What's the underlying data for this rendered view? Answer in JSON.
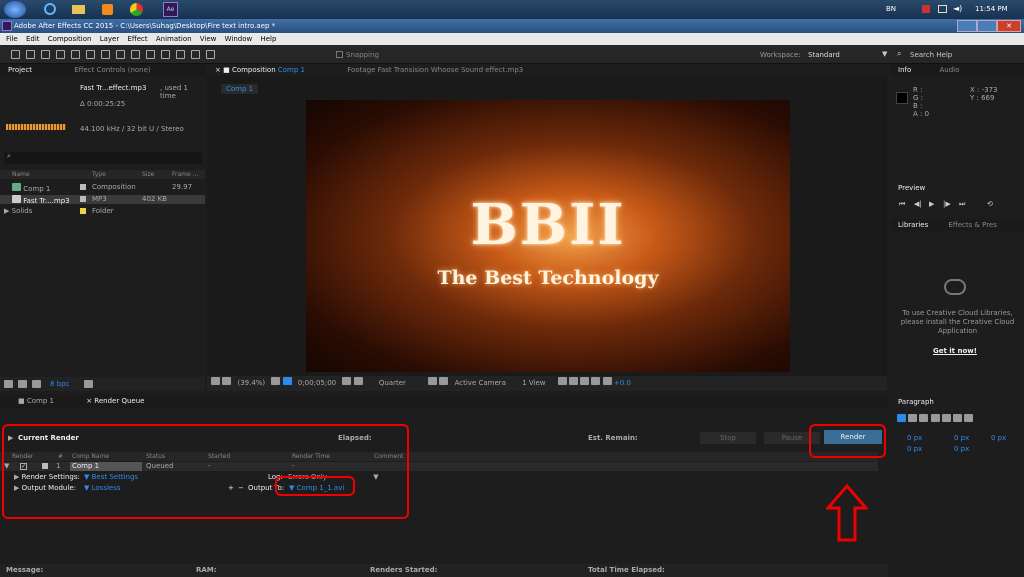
{
  "taskbar": {
    "lang": "BN",
    "time": "11:54 PM"
  },
  "window": {
    "title": "Adobe After Effects CC 2015 - C:\\Users\\Suhag\\Desktop\\Fire text intro.aep *"
  },
  "menu": [
    "File",
    "Edit",
    "Composition",
    "Layer",
    "Effect",
    "Animation",
    "View",
    "Window",
    "Help"
  ],
  "toolbar": {
    "snapping": "Snapping",
    "workspace_label": "Workspace:",
    "workspace_value": "Standard",
    "search": "Search Help"
  },
  "project": {
    "tab": "Project",
    "effect_controls": "Effect Controls (none)",
    "file_name": "Fast Tr...effect.mp3",
    "used": ", used 1 time",
    "duration": "Δ 0:00:25:25",
    "audio_info": "44.100 kHz / 32 bit U / Stereo",
    "headers": [
      "Name",
      "Type",
      "Size",
      "Frame ..."
    ],
    "items": [
      {
        "name": "Comp 1",
        "type": "Composition",
        "size": "",
        "frame": "29.97"
      },
      {
        "name": "Fast Tr....mp3",
        "type": "MP3",
        "size": "402 KB",
        "frame": ""
      },
      {
        "name": "Solids",
        "type": "Folder",
        "size": "",
        "frame": ""
      }
    ],
    "bpc": "8 bpc"
  },
  "comp": {
    "tab_prefix": "Composition",
    "tab_name": "Comp 1",
    "footage": "Footage Fast Transision Whoose Sound effect.mp3",
    "sub_tab": "Comp 1",
    "title_text": "BBII",
    "subtitle_text": "The Best Technology",
    "zoom": "(39.4%)",
    "timecode": "0;00;05;00",
    "resolution": "Quarter",
    "camera": "Active Camera",
    "view": "1 View",
    "exposure": "+0.0"
  },
  "info": {
    "tab": "Info",
    "audio": "Audio",
    "r": "R :",
    "g": "G :",
    "b": "B :",
    "a": "A : 0",
    "x": "X : -373",
    "y": "Y : 669"
  },
  "preview": {
    "tab": "Preview"
  },
  "libraries": {
    "tab": "Libraries",
    "effects": "Effects & Pres",
    "msg": "To use Creative Cloud Libraries, please install the Creative Cloud Application",
    "link": "Get it now!"
  },
  "paragraph": {
    "tab": "Paragraph",
    "v1": "0 px",
    "v2": "0 px",
    "v3": "0 px",
    "v4": "0 px",
    "v5": "0 px"
  },
  "rq": {
    "comp_tab": "Comp 1",
    "tab": "Render Queue",
    "current_render": "Current Render",
    "elapsed": "Elapsed:",
    "remain": "Est. Remain:",
    "stop": "Stop",
    "pause": "Pause",
    "render": "Render",
    "headers": [
      "Render",
      "#",
      "Comp Name",
      "Status",
      "Started",
      "Render Time",
      "Comment"
    ],
    "item": {
      "num": "1",
      "name": "Comp 1",
      "status": "Queued",
      "started": "-",
      "render_time": "-"
    },
    "render_settings_label": "Render Settings:",
    "render_settings_value": "Best Settings",
    "log_label": "Log:",
    "log_value": "Errors Only",
    "output_module_label": "Output Module:",
    "output_module_value": "Lossless",
    "output_to_label": "Output To:",
    "output_to_value": "Comp 1_1.avi",
    "footer": {
      "message": "Message:",
      "ram": "RAM:",
      "renders_started": "Renders Started:",
      "total_time": "Total Time Elapsed:"
    }
  }
}
